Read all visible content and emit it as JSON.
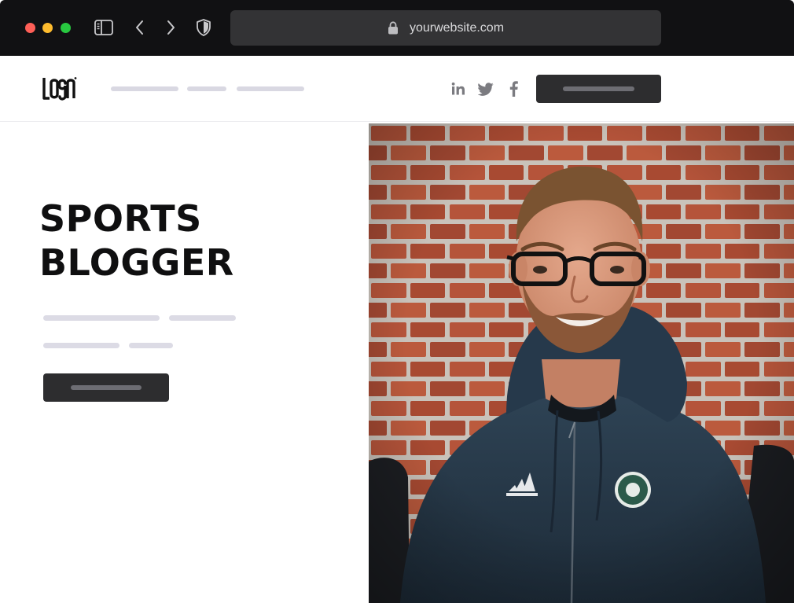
{
  "browser": {
    "url": "yourwebsite.com",
    "traffic_light_colors": [
      "#fe5f57",
      "#febc2e",
      "#28c840"
    ],
    "icons": [
      "sidebar-icon",
      "back-arrow-icon",
      "forward-arrow-icon",
      "shield-icon",
      "lock-icon"
    ]
  },
  "header": {
    "logo_text": "LOGO",
    "nav_placeholders": 3,
    "social_icons": [
      "linkedin-icon",
      "twitter-icon",
      "facebook-icon"
    ],
    "cta_color": "#2d2d2f"
  },
  "hero": {
    "title_line1": "SPORTS",
    "title_line2": "BLOGGER",
    "text_placeholder_color": "#dcdbe5",
    "button_color": "#2d2d2f",
    "photo_alt": "Portrait of a smiling bearded man with glasses in a navy hoodie in front of a brick wall"
  }
}
